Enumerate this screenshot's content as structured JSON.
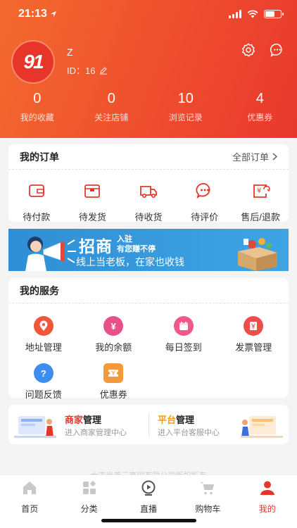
{
  "status_bar": {
    "time": "21:13"
  },
  "profile": {
    "avatar_text": "91",
    "username": "Z",
    "id_text": "ID：16"
  },
  "stats": [
    {
      "value": "0",
      "label": "我的收藏"
    },
    {
      "value": "0",
      "label": "关注店铺"
    },
    {
      "value": "10",
      "label": "浏览记录"
    },
    {
      "value": "4",
      "label": "优惠券"
    }
  ],
  "orders": {
    "title": "我的订单",
    "all_label": "全部订单",
    "items": [
      {
        "label": "待付款",
        "icon": "wallet-icon"
      },
      {
        "label": "待发货",
        "icon": "box-icon"
      },
      {
        "label": "待收货",
        "icon": "truck-icon"
      },
      {
        "label": "待评价",
        "icon": "comment-icon"
      },
      {
        "label": "售后/退款",
        "icon": "refund-icon"
      }
    ]
  },
  "banner": {
    "headline": "招商",
    "tag_line1": "入驻",
    "tag_line2": "有您赚不停",
    "subline": "线上当老板，在家也收钱"
  },
  "services": {
    "title": "我的服务",
    "items": [
      {
        "label": "地址管理",
        "icon": "location-icon",
        "color": "#f0563a"
      },
      {
        "label": "我的余额",
        "icon": "money-bag-icon",
        "color": "#e8508a"
      },
      {
        "label": "每日签到",
        "icon": "calendar-icon",
        "color": "#f0588a"
      },
      {
        "label": "发票管理",
        "icon": "invoice-icon",
        "color": "#ee4d4a"
      },
      {
        "label": "问题反馈",
        "icon": "question-icon",
        "color": "#3d8ef0"
      },
      {
        "label": "优惠券",
        "icon": "coupon-icon",
        "color": "#f59a3a"
      }
    ]
  },
  "management": {
    "merchant": {
      "accent": "商家",
      "rest": "管理",
      "subtitle": "进入商家管理中心"
    },
    "platform": {
      "accent": "平台",
      "rest": "管理",
      "subtitle": "进入平台客服中心"
    }
  },
  "footnote": "大连尚美云商网有限公司版权所有",
  "tabs": [
    {
      "label": "首页",
      "icon": "home-icon"
    },
    {
      "label": "分类",
      "icon": "category-icon"
    },
    {
      "label": "直播",
      "icon": "live-icon"
    },
    {
      "label": "购物车",
      "icon": "cart-icon"
    },
    {
      "label": "我的",
      "icon": "user-icon",
      "active": true
    }
  ],
  "colors": {
    "brand": "#e8352a",
    "header_gradient_start": "#f36a2e",
    "header_gradient_end": "#e8382d"
  }
}
